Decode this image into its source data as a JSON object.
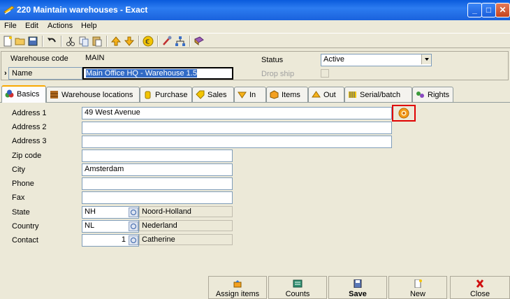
{
  "window": {
    "title": "220 Maintain warehouses - Exact",
    "minimize": "_",
    "maximize": "□",
    "close": "✕"
  },
  "menu": {
    "items": [
      "File",
      "Edit",
      "Actions",
      "Help"
    ]
  },
  "toolbar": {
    "icons": [
      "new-icon",
      "open-icon",
      "save-icon",
      "undo-icon",
      "cut-icon",
      "copy-icon",
      "paste-icon",
      "up-icon",
      "down-icon",
      "euro-icon",
      "tools-icon",
      "network-icon",
      "book-icon"
    ]
  },
  "header": {
    "warehouse_code_label": "Warehouse code",
    "warehouse_code_value": "MAIN",
    "name_label": "Name",
    "name_value": "Main Office HQ - Warehouse 1.5",
    "status_label": "Status",
    "status_value": "Active",
    "drop_ship_label": "Drop ship",
    "row_marker": "›"
  },
  "tabs": [
    {
      "label": "Basics",
      "icon": "basics-icon"
    },
    {
      "label": "Warehouse locations",
      "icon": "shelves-icon"
    },
    {
      "label": "Purchase",
      "icon": "purchase-icon"
    },
    {
      "label": "Sales",
      "icon": "sales-icon"
    },
    {
      "label": "In",
      "icon": "in-icon"
    },
    {
      "label": "Items",
      "icon": "items-icon"
    },
    {
      "label": "Out",
      "icon": "out-icon"
    },
    {
      "label": "Serial/batch",
      "icon": "serial-icon"
    },
    {
      "label": "Rights",
      "icon": "rights-icon"
    }
  ],
  "basics": {
    "address1_label": "Address 1",
    "address1_value": "49 West Avenue",
    "address2_label": "Address 2",
    "address2_value": "",
    "address3_label": "Address 3",
    "address3_value": "",
    "zip_label": "Zip code",
    "zip_value": "",
    "city_label": "City",
    "city_value": "Amsterdam",
    "phone_label": "Phone",
    "phone_value": "",
    "fax_label": "Fax",
    "fax_value": "",
    "state_label": "State",
    "state_code": "NH",
    "state_name": "Noord-Holland",
    "country_label": "Country",
    "country_code": "NL",
    "country_name": "Nederland",
    "contact_label": "Contact",
    "contact_number": "1",
    "contact_name": "Catherine"
  },
  "footer": {
    "assign_items": "Assign items",
    "counts": "Counts",
    "save": "Save",
    "new": "New",
    "close": "Close"
  },
  "colors": {
    "titlebar": "#0a5bdc",
    "highlight": "#316ac5",
    "map_button_border": "#e00000",
    "map_button": "#f59a17"
  }
}
